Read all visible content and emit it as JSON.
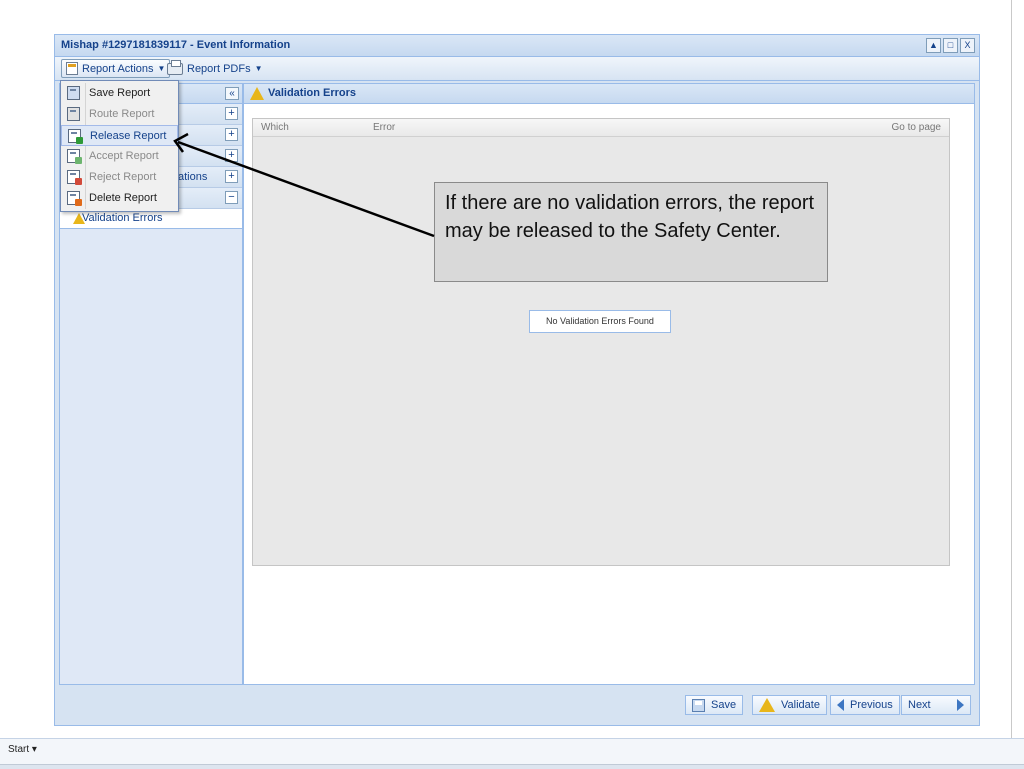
{
  "window": {
    "title": "Mishap #129718183911​7 - Event Information",
    "tools": [
      "▲",
      "□",
      "X"
    ]
  },
  "toolbar": {
    "report_actions": "Report Actions",
    "report_pdfs": "Report PDFs"
  },
  "menu": {
    "items": [
      {
        "label": "Save Report",
        "disabled": false
      },
      {
        "label": "Route Report",
        "disabled": true
      },
      {
        "label": "Release Report",
        "disabled": false
      },
      {
        "label": "Accept Report",
        "disabled": true
      },
      {
        "label": "Reject Report",
        "disabled": true
      },
      {
        "label": "Delete Report",
        "disabled": false
      }
    ]
  },
  "left_panel": {
    "collapse": "«",
    "partial_row": "ations",
    "child": "Validation Errors"
  },
  "right_panel": {
    "title": "Validation Errors",
    "columns": [
      "Which",
      "Error",
      "Go to page"
    ],
    "empty_text": "No Validation Errors Found"
  },
  "buttons": {
    "save": "Save",
    "validate": "Validate",
    "previous": "Previous",
    "next": "Next"
  },
  "callout": {
    "text": "If there are no validation errors, the report may be released to the Safety Center."
  },
  "taskbar": {
    "start": "Start ▾"
  }
}
